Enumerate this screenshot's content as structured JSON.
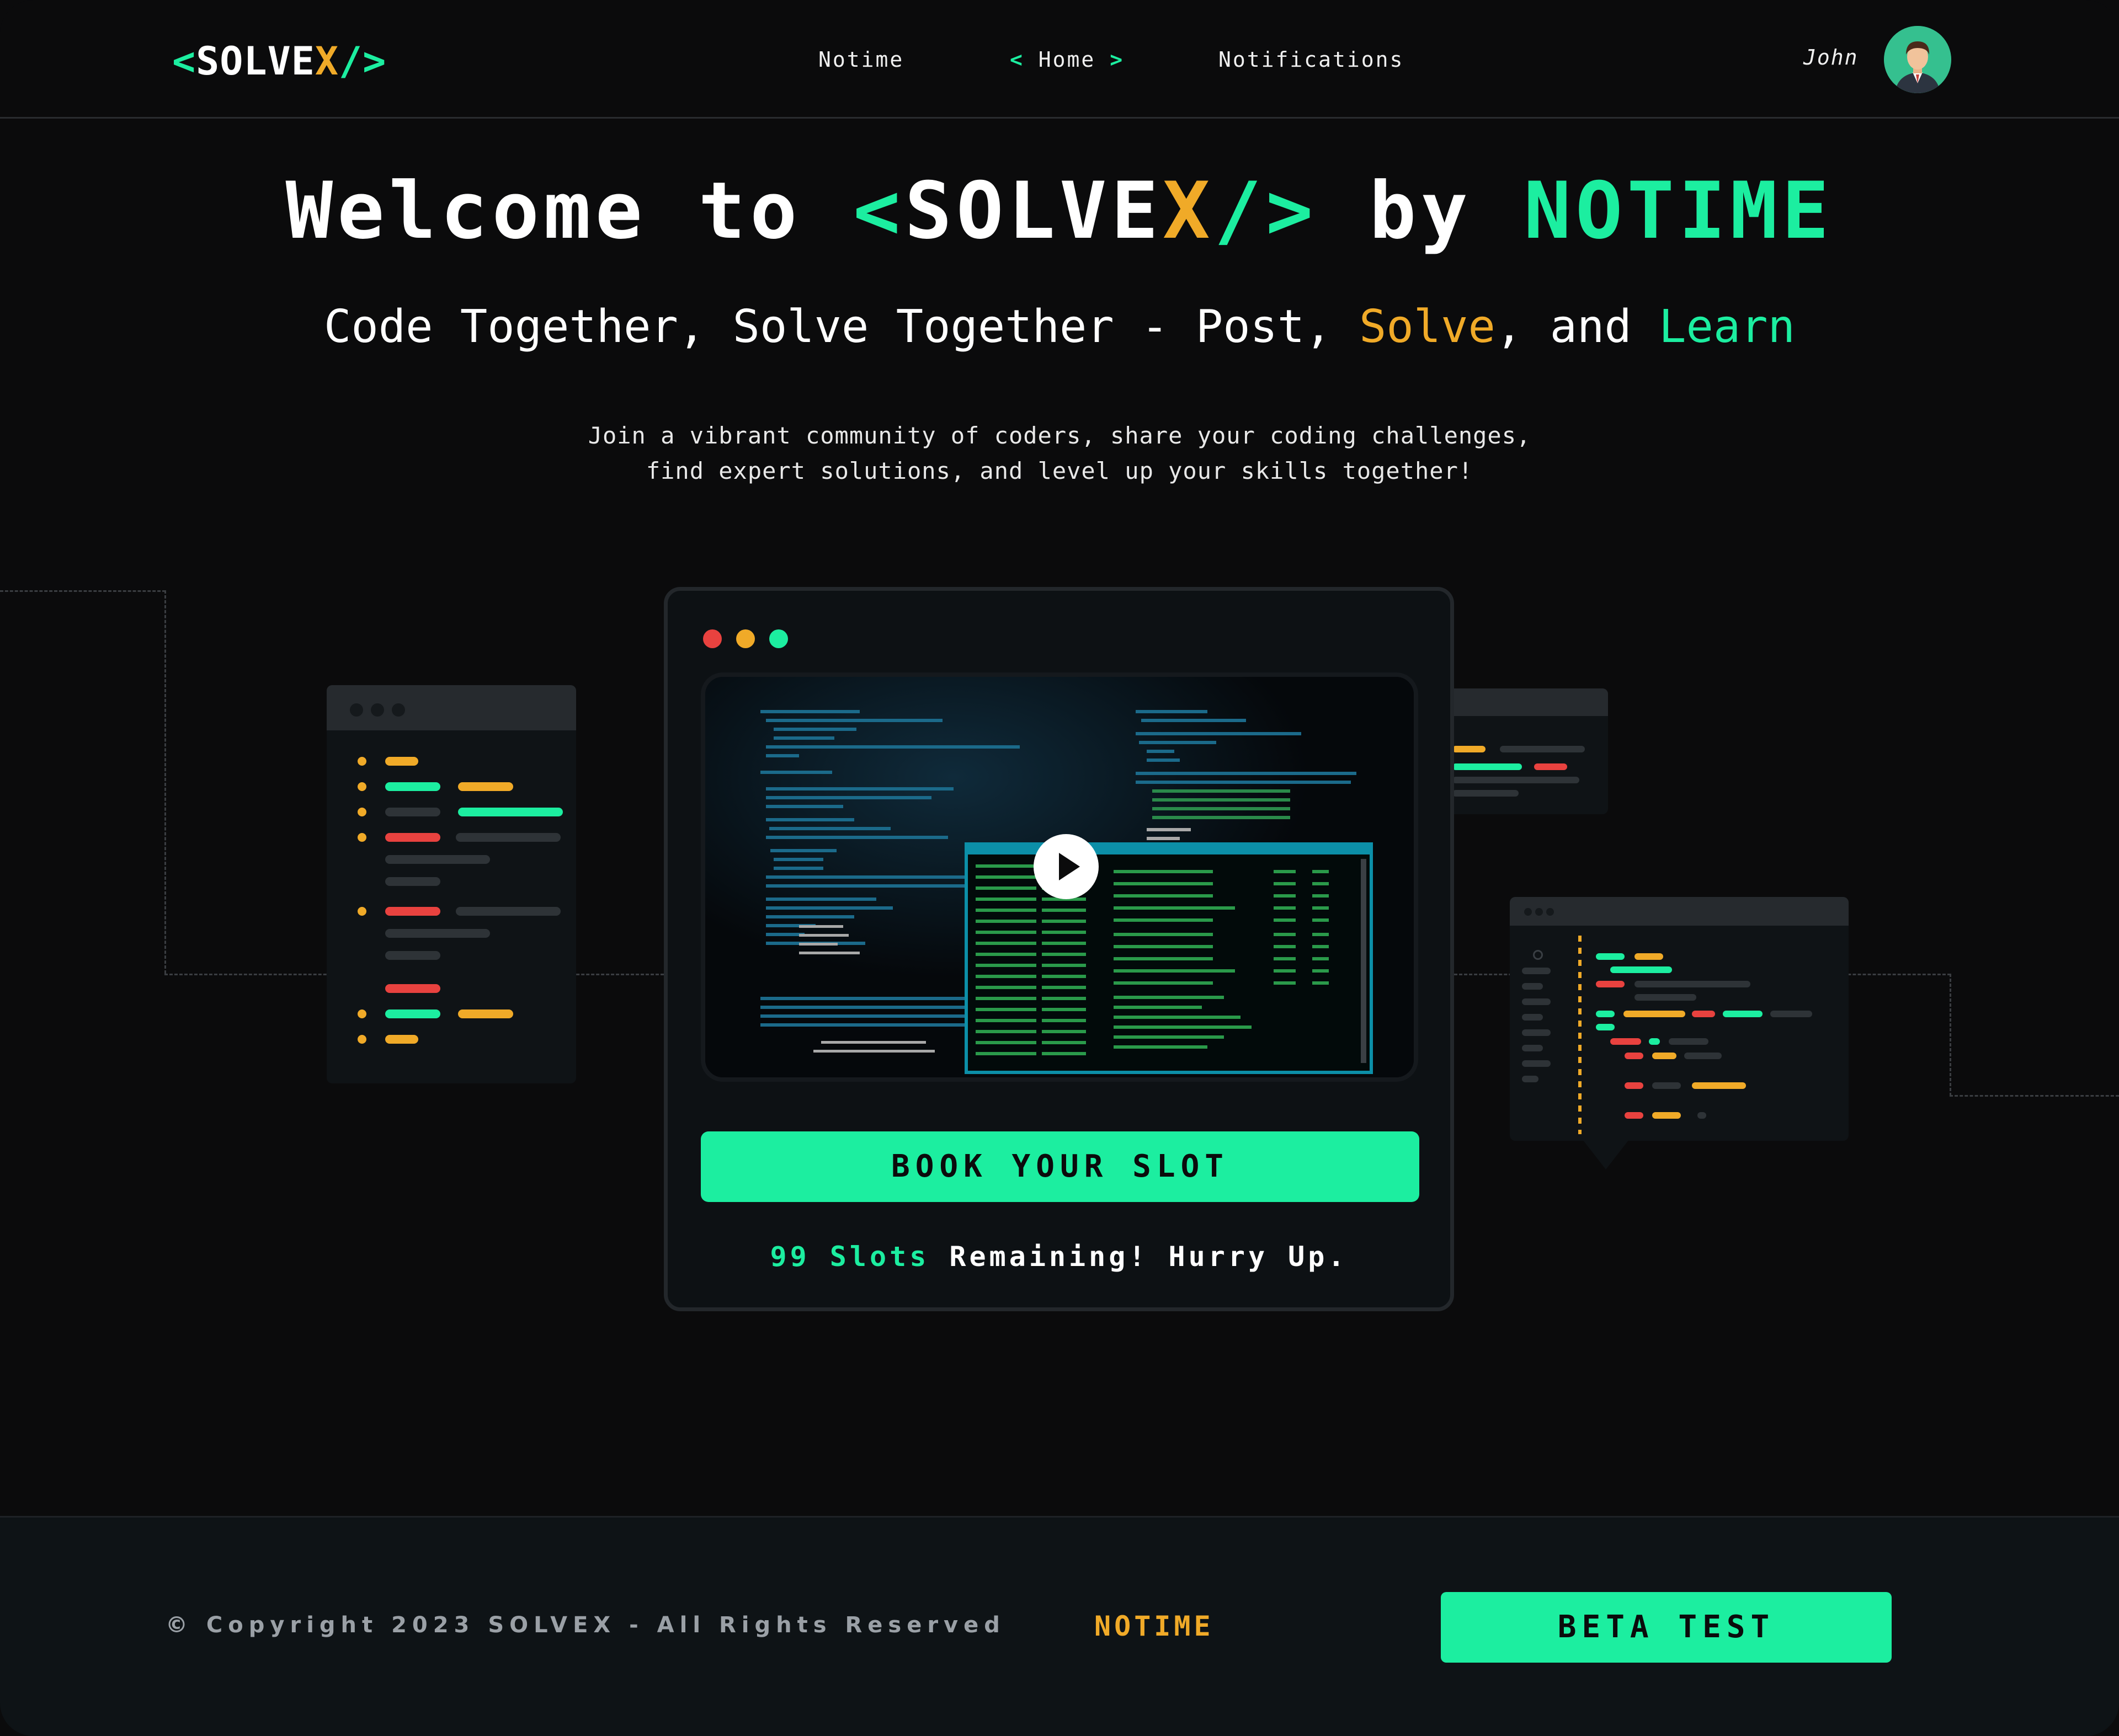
{
  "brand": {
    "open": "<",
    "solve": "SOLVE",
    "x": "X",
    "close": "/>"
  },
  "nav": {
    "links": [
      "Notime",
      "Home",
      "Notifications"
    ],
    "active": "Home",
    "home_chev_left": "<",
    "home_chev_right": ">"
  },
  "user": {
    "name": "John"
  },
  "hero": {
    "title_prefix": "Welcome to ",
    "title_brand_open": "<",
    "title_brand_solve": "SOLVE",
    "title_brand_x": "X",
    "title_brand_close": "/>",
    "title_by": " by ",
    "title_notime": "NOTIME",
    "subtitle_part1": "Code Together, Solve Together - Post, ",
    "subtitle_solve": "Solve",
    "subtitle_part2": ", and ",
    "subtitle_learn": "Learn",
    "desc_line1": "Join a vibrant community of coders, share your coding challenges,",
    "desc_line2": "find expert solutions, and level up your skills together!"
  },
  "card": {
    "cta_label": "BOOK YOUR SLOT",
    "slots_count": "99 Slots",
    "slots_text": " Remaining! Hurry Up."
  },
  "footer": {
    "copyright": "© Copyright 2023 SOLVEX - All Rights Reserved",
    "notime": "NOTIME",
    "beta_label": "BETA TEST"
  },
  "colors": {
    "accent_green": "#1ceea0",
    "accent_orange": "#f0aa28",
    "accent_red": "#e8423f",
    "background": "#0b0b0c"
  },
  "icons": [
    "play-icon",
    "avatar"
  ]
}
